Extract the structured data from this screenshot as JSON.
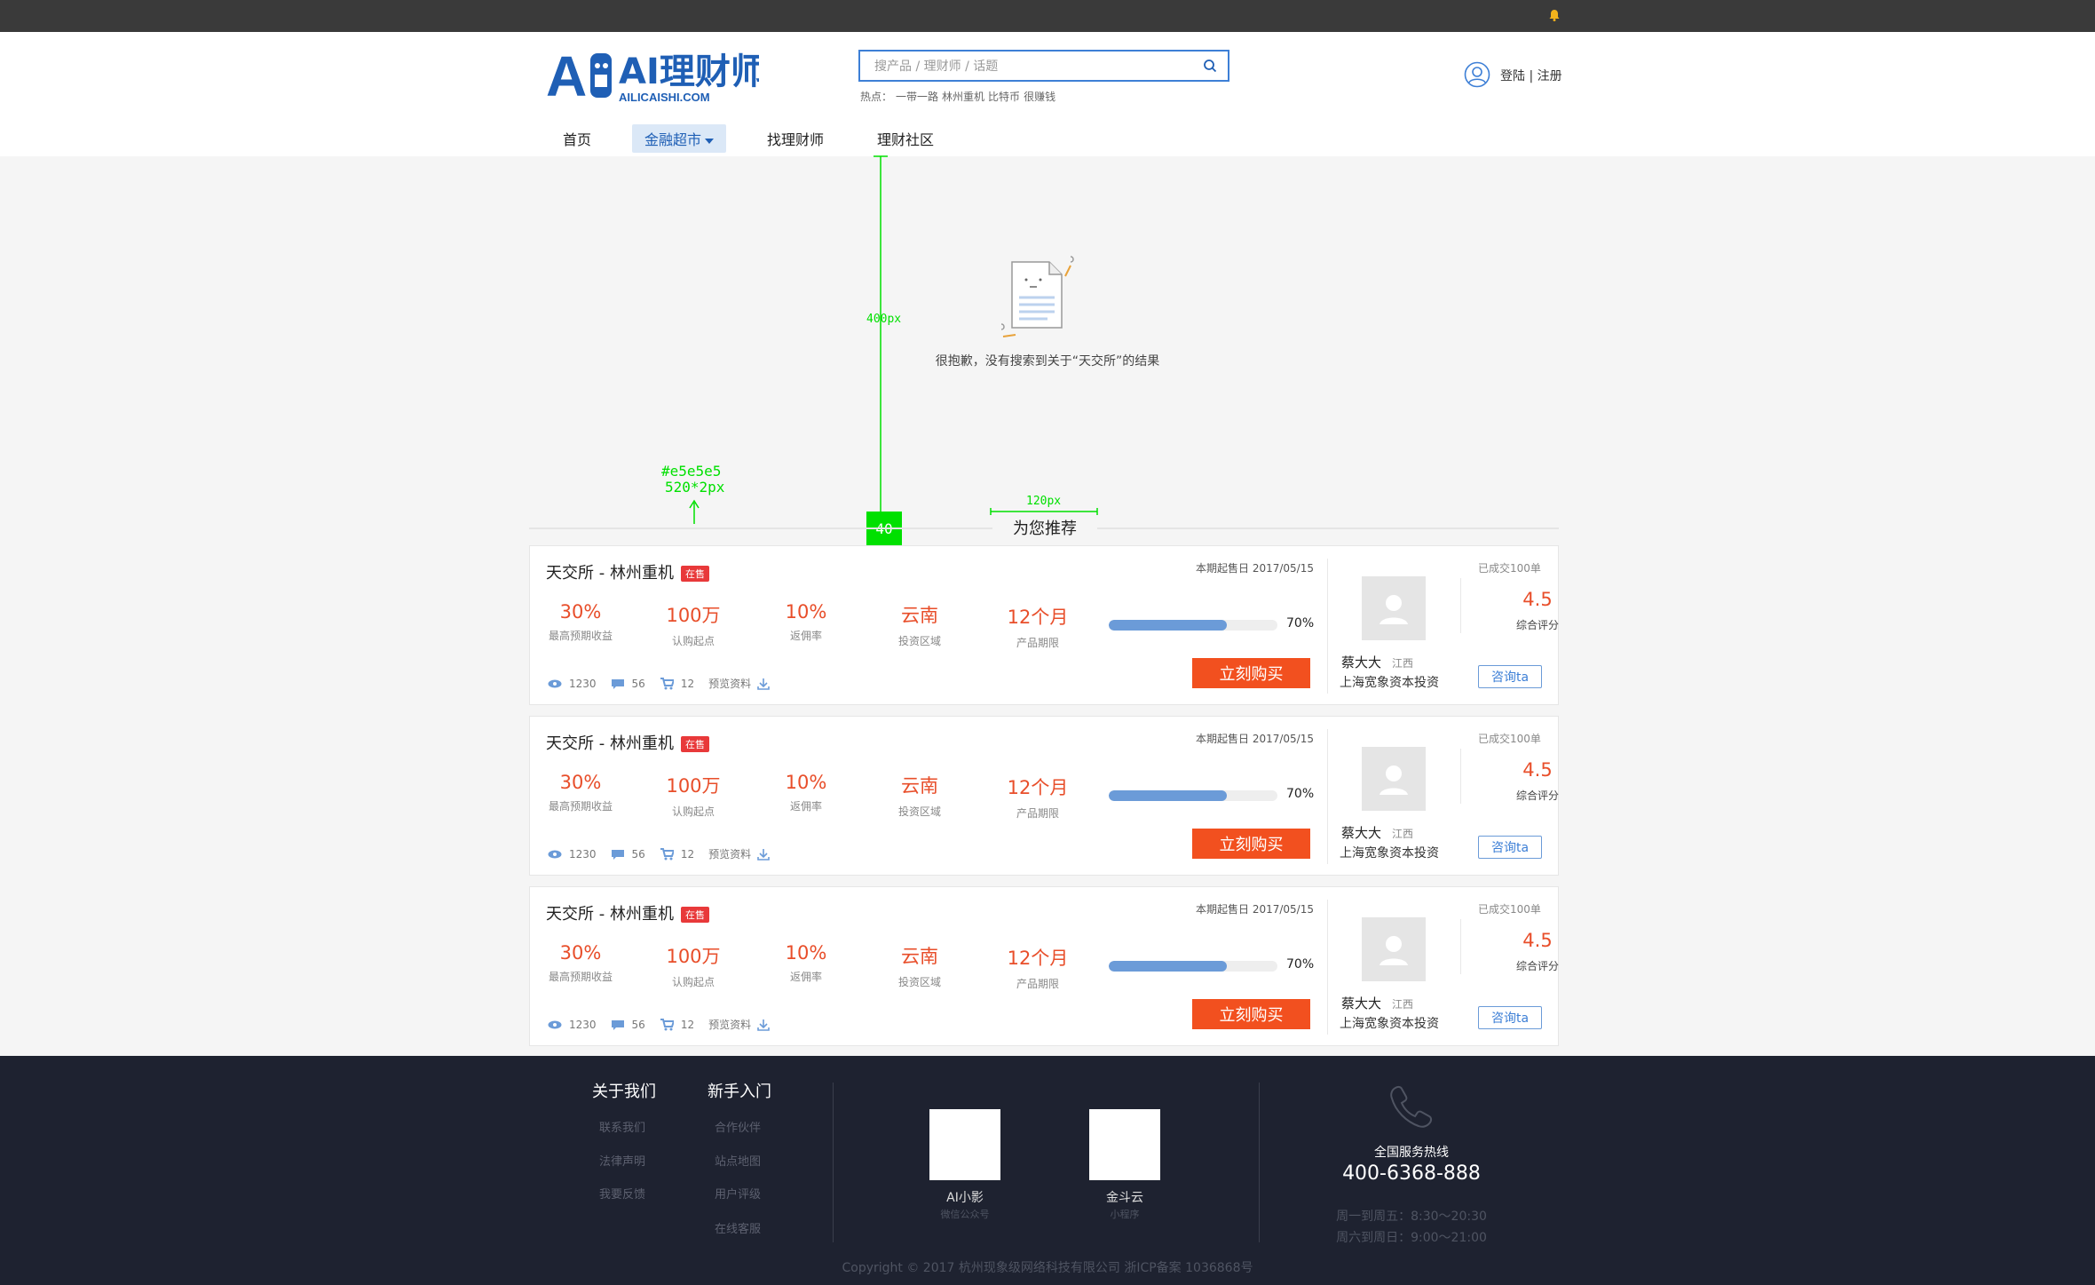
{
  "header": {
    "logo_text": "AI理财师",
    "logo_sub": "AILICAISHI.COM",
    "search_placeholder": "搜产品 / 理财师 / 话题",
    "hot_label": "热点：",
    "hot_tags": [
      "一带一路",
      "林州重机",
      "比特币",
      "很赚钱"
    ],
    "login": "登陆",
    "separator": "|",
    "register": "注册"
  },
  "nav": {
    "items": [
      "首页",
      "金融超市",
      "找理财师",
      "理财社区"
    ]
  },
  "annotations": {
    "height_note": "400px",
    "color_note": "#e5e5e5",
    "size_note": "520*2px",
    "gap_note": "40",
    "width_note": "120px"
  },
  "empty_state": {
    "message": "很抱歉，没有搜索到关于“天交所”的结果"
  },
  "recommend": {
    "title": "为您推荐"
  },
  "products": [
    {
      "title": "天交所 - 林州重机",
      "badge": "在售",
      "date": "本期起售日 2017/05/15",
      "metrics": [
        {
          "value": "30%",
          "label": "最高预期收益"
        },
        {
          "value": "100万",
          "label": "认购起点"
        },
        {
          "value": "10%",
          "label": "返佣率"
        },
        {
          "value": "云南",
          "label": "投资区域"
        },
        {
          "value": "12个月",
          "label": "产品期限"
        }
      ],
      "progress": 0.7,
      "progress_text": "70%",
      "views": "1230",
      "comments": "56",
      "carts": "12",
      "preview": "预览资料",
      "buy": "立刻购买",
      "advisor": {
        "name": "蔡大大",
        "location": "江西",
        "company": "上海宽象资本投资",
        "deals": "已成交100单",
        "score": "4.5",
        "score_label": "综合评分",
        "consult": "咨询ta"
      }
    },
    {
      "title": "天交所 - 林州重机",
      "badge": "在售",
      "date": "本期起售日 2017/05/15",
      "metrics": [
        {
          "value": "30%",
          "label": "最高预期收益"
        },
        {
          "value": "100万",
          "label": "认购起点"
        },
        {
          "value": "10%",
          "label": "返佣率"
        },
        {
          "value": "云南",
          "label": "投资区域"
        },
        {
          "value": "12个月",
          "label": "产品期限"
        }
      ],
      "progress": 0.7,
      "progress_text": "70%",
      "views": "1230",
      "comments": "56",
      "carts": "12",
      "preview": "预览资料",
      "buy": "立刻购买",
      "advisor": {
        "name": "蔡大大",
        "location": "江西",
        "company": "上海宽象资本投资",
        "deals": "已成交100单",
        "score": "4.5",
        "score_label": "综合评分",
        "consult": "咨询ta"
      }
    },
    {
      "title": "天交所 - 林州重机",
      "badge": "在售",
      "date": "本期起售日 2017/05/15",
      "metrics": [
        {
          "value": "30%",
          "label": "最高预期收益"
        },
        {
          "value": "100万",
          "label": "认购起点"
        },
        {
          "value": "10%",
          "label": "返佣率"
        },
        {
          "value": "云南",
          "label": "投资区域"
        },
        {
          "value": "12个月",
          "label": "产品期限"
        }
      ],
      "progress": 0.7,
      "progress_text": "70%",
      "views": "1230",
      "comments": "56",
      "carts": "12",
      "preview": "预览资料",
      "buy": "立刻购买",
      "advisor": {
        "name": "蔡大大",
        "location": "江西",
        "company": "上海宽象资本投资",
        "deals": "已成交100单",
        "score": "4.5",
        "score_label": "综合评分",
        "consult": "咨询ta"
      }
    }
  ],
  "footer": {
    "about": {
      "title": "关于我们",
      "links": [
        "联系我们",
        "法律声明",
        "我要反馈"
      ]
    },
    "newbie": {
      "title": "新手入门",
      "links": [
        "合作伙伴",
        "站点地图",
        "用户评级",
        "在线客服"
      ]
    },
    "qrcodes": [
      {
        "name": "AI小影",
        "sub": "微信公众号"
      },
      {
        "name": "金斗云",
        "sub": "小程序"
      }
    ],
    "hotline_label": "全国服务热线",
    "hotline": "400-6368-888",
    "hours": [
      "周一到周五：8:30～20:30",
      "周六到周日：9:00～21:00"
    ],
    "copyright": "Copyright © 2017 杭州现象级网络科技有限公司 浙ICP备案 1036868号"
  },
  "colors": {
    "accent": "#3d7fd6",
    "price": "#e84e2a",
    "buy": "#f2501f",
    "annotation": "#00e000",
    "footer_bg": "#1e2230"
  }
}
